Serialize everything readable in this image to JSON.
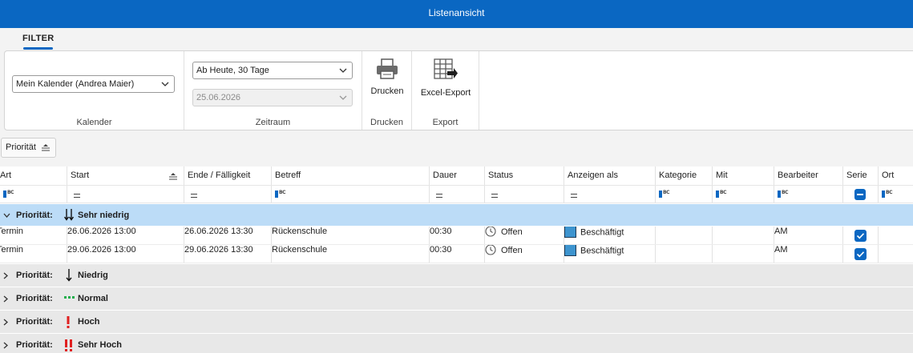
{
  "window": {
    "title": "Listenansicht"
  },
  "ribbon": {
    "tab_filter": "FILTER",
    "calendar": {
      "selected": "Mein Kalender (Andrea Maier)",
      "group_label": "Kalender"
    },
    "timerange": {
      "range": "Ab Heute, 30 Tage",
      "date": "25.06.2026",
      "group_label": "Zeitraum"
    },
    "print": {
      "label": "Drucken",
      "group_label": "Drucken"
    },
    "export": {
      "label": "Excel-Export",
      "group_label": "Export"
    }
  },
  "grouping": {
    "chip_label": "Priorität"
  },
  "columns": [
    "Art",
    "Start",
    "Ende / Fälligkeit",
    "Betreff",
    "Dauer",
    "Status",
    "Anzeigen als",
    "Kategorie",
    "Mit",
    "Bearbeiter",
    "Serie",
    "Ort"
  ],
  "group_prefix": "Priorität:",
  "groups": [
    {
      "value": "Sehr niedrig",
      "expanded": true,
      "icon": "double-arrow-down-icon"
    },
    {
      "value": "Niedrig",
      "expanded": false,
      "icon": "arrow-down-icon"
    },
    {
      "value": "Normal",
      "expanded": false,
      "icon": "dots-icon"
    },
    {
      "value": "Hoch",
      "expanded": false,
      "icon": "exclamation-icon"
    },
    {
      "value": "Sehr Hoch",
      "expanded": false,
      "icon": "double-exclamation-icon"
    }
  ],
  "rows": [
    {
      "art": "Termin",
      "start": "26.06.2026 13:00",
      "ende": "26.06.2026 13:30",
      "betreff": "Rückenschule",
      "dauer": "00:30",
      "status": "Offen",
      "anzeigen": "Beschäftigt",
      "kategorie": "",
      "mit": "",
      "bearbeiter": "AM",
      "serie": true,
      "ort": ""
    },
    {
      "art": "Termin",
      "start": "29.06.2026 13:00",
      "ende": "29.06.2026 13:30",
      "betreff": "Rückenschule",
      "dauer": "00:30",
      "status": "Offen",
      "anzeigen": "Beschäftigt",
      "kategorie": "",
      "mit": "",
      "bearbeiter": "AM",
      "serie": true,
      "ort": ""
    }
  ],
  "colors": {
    "accent": "#0a67c2",
    "group_active": "#bcdcf7",
    "group_row": "#e8e8e8",
    "busy": "#3d94cf",
    "normal_dots": "#1fae4b",
    "high": "#e02020"
  }
}
